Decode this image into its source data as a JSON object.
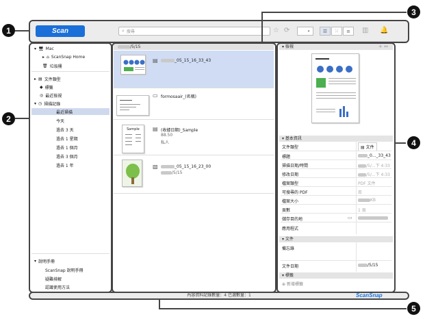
{
  "callouts": [
    "1",
    "2",
    "3",
    "4",
    "5"
  ],
  "toolbar": {
    "scan_label": "Scan",
    "search_placeholder": "搜尋",
    "search_icon": "magnifier-icon"
  },
  "sidebar": {
    "mac": "Mac",
    "scansnap_home": "ScanSnap Home",
    "trash": "垃圾桶",
    "doc_types": "文件類型",
    "tags": "標籤",
    "recent_search": "最近檢視",
    "scan_records": "掃描記錄",
    "scan_sub": [
      "最近掃描",
      "今天",
      "過去 3 天",
      "過去 1 星期",
      "過去 1 個月",
      "過去 3 個月",
      "過去 1 年"
    ],
    "manual_header": "說明手冊",
    "manual_items": [
      "ScanSnap 說明手冊",
      "疑難排解",
      "認識使用方法"
    ]
  },
  "list": {
    "header_date": "/5/15",
    "rows": [
      {
        "title": "_05_15_16_33_43",
        "sub": ""
      },
      {
        "title": "formosaair_(名稱)",
        "sub": ""
      },
      {
        "title": "(收據日期)_Sample",
        "sub": "88.50",
        "sub2": "私人"
      },
      {
        "title": "_05_15_16_23_00",
        "sub": "/5/15"
      }
    ],
    "thumb2_text": "Sample"
  },
  "info": {
    "preview_header": "檢視",
    "basic_header": "基本資訊",
    "props": [
      {
        "label": "文件類型",
        "value": "文件"
      },
      {
        "label": "標題",
        "value": "_0..._33_43"
      },
      {
        "label": "掃描日期/時間",
        "value": "/5/...下 4:33"
      },
      {
        "label": "修改日期",
        "value": "/5/...下 4:33"
      },
      {
        "label": "檔案類型",
        "value": "PDF 文件"
      },
      {
        "label": "可搜尋的 PDF",
        "value": "否"
      },
      {
        "label": "檔案大小",
        "value": "KB"
      },
      {
        "label": "頁數",
        "value": "1 頁"
      },
      {
        "label": "儲存目的地",
        "value": ""
      },
      {
        "label": "應用程式",
        "value": ""
      }
    ],
    "doc_header": "文件",
    "memo_label": "備忘錄",
    "doc_date_label": "文件日期",
    "doc_date_value": "/5/15",
    "tag_header": "標籤",
    "add_tag": "新增標籤"
  },
  "status": {
    "text": "內容資料記錄數量：4  已選數量：1",
    "brand": "ScanSnap"
  }
}
